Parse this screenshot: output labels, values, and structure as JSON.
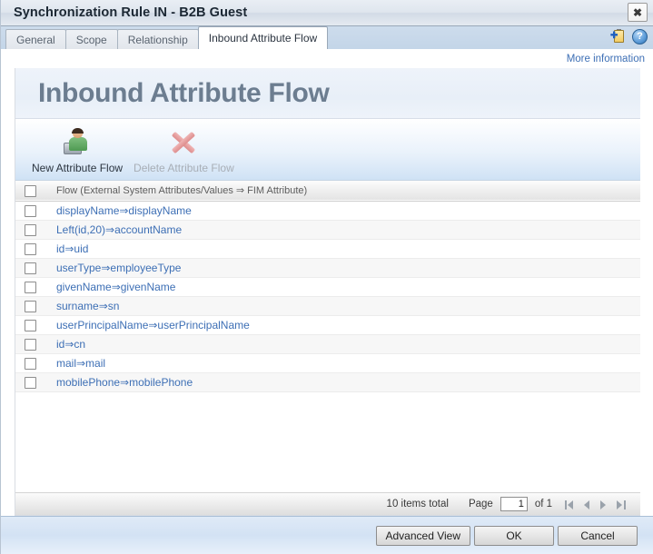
{
  "window": {
    "title": "Synchronization Rule IN - B2B Guest",
    "close_label": "✖"
  },
  "tabs": [
    {
      "label": "General",
      "active": false
    },
    {
      "label": "Scope",
      "active": false
    },
    {
      "label": "Relationship",
      "active": false
    },
    {
      "label": "Inbound Attribute Flow",
      "active": true
    }
  ],
  "tab_icons": {
    "clipboard_plus": "clipboard-add-icon",
    "help": "?"
  },
  "links": {
    "more_information": "More information"
  },
  "panel": {
    "heading": "Inbound Attribute Flow"
  },
  "toolbar": {
    "new_attribute_flow": "New Attribute Flow",
    "delete_attribute_flow": "Delete Attribute Flow"
  },
  "table": {
    "column_header": "Flow (External System Attributes/Values ⇒ FIM Attribute)",
    "rows": [
      {
        "flow": "displayName⇒displayName"
      },
      {
        "flow": "Left(id,20)⇒accountName"
      },
      {
        "flow": "id⇒uid"
      },
      {
        "flow": "userType⇒employeeType"
      },
      {
        "flow": "givenName⇒givenName"
      },
      {
        "flow": "surname⇒sn"
      },
      {
        "flow": "userPrincipalName⇒userPrincipalName"
      },
      {
        "flow": "id⇒cn"
      },
      {
        "flow": "mail⇒mail"
      },
      {
        "flow": "mobilePhone⇒mobilePhone"
      }
    ]
  },
  "pager": {
    "items_total": "10 items total",
    "page_label": "Page",
    "page_value": "1",
    "of_label": "of 1",
    "first_title": "first-page",
    "prev_title": "previous-page",
    "next_title": "next-page",
    "last_title": "last-page"
  },
  "footer": {
    "advanced_view": "Advanced View",
    "ok": "OK",
    "cancel": "Cancel"
  },
  "colors": {
    "link": "#3d6fb5",
    "heading": "#6c7d90",
    "tab_active_bg": "#ffffff",
    "tabstrip_bg": "#c3d5e8",
    "footer_bg": "#d3e2f4"
  }
}
